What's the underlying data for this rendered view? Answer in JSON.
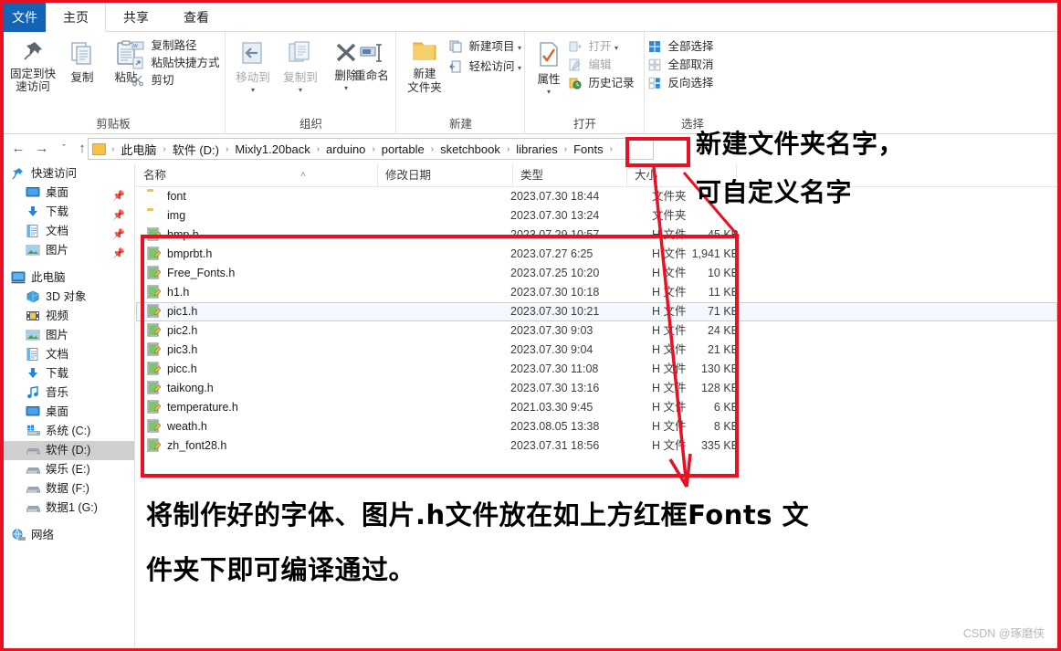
{
  "window": {
    "tabs": [
      {
        "label": "文件",
        "name": "tab-file"
      },
      {
        "label": "主页",
        "name": "tab-home"
      },
      {
        "label": "共享",
        "name": "tab-share"
      },
      {
        "label": "查看",
        "name": "tab-view"
      }
    ]
  },
  "ribbon": {
    "clipboard": {
      "group_label": "剪贴板",
      "pin_to_quick_access": "固定到快\n速访问",
      "pin_line1": "固定到快",
      "pin_line2": "速访问",
      "copy": "复制",
      "paste": "粘贴",
      "copy_path": "复制路径",
      "paste_shortcut": "粘贴快捷方式",
      "cut": "剪切"
    },
    "organize": {
      "group_label": "组织",
      "move_to": "移动到",
      "copy_to": "复制到",
      "delete": "删除",
      "rename": "重命名"
    },
    "new": {
      "group_label": "新建",
      "new_folder_line1": "新建",
      "new_folder_line2": "文件夹",
      "new_item": "新建项目",
      "easy_access": "轻松访问"
    },
    "open": {
      "group_label": "打开",
      "properties": "属性",
      "open": "打开",
      "edit": "编辑",
      "history": "历史记录"
    },
    "select": {
      "group_label": "选择",
      "select_all": "全部选择",
      "select_none": "全部取消",
      "invert_selection": "反向选择"
    }
  },
  "address": {
    "back_icon": "←",
    "forward_icon": "→",
    "recent_icon": "ˇ",
    "up_icon": "↑",
    "breadcrumbs": [
      "此电脑",
      "软件 (D:)",
      "Mixly1.20back",
      "arduino",
      "portable",
      "sketchbook",
      "libraries",
      "Fonts"
    ],
    "separator": "›"
  },
  "sidebar": {
    "groups": [
      {
        "header": {
          "label": "快速访问",
          "icon": "star-pin-icon",
          "name": "sidebar-item-quick-access"
        },
        "items": [
          {
            "label": "桌面",
            "icon": "desktop-icon",
            "pinned": true,
            "name": "sidebar-item-desktop"
          },
          {
            "label": "下载",
            "icon": "download-icon",
            "pinned": true,
            "name": "sidebar-item-downloads"
          },
          {
            "label": "文档",
            "icon": "documents-icon",
            "pinned": true,
            "name": "sidebar-item-documents"
          },
          {
            "label": "图片",
            "icon": "pictures-icon",
            "pinned": true,
            "name": "sidebar-item-pictures"
          }
        ]
      },
      {
        "header": {
          "label": "此电脑",
          "icon": "this-pc-icon",
          "name": "sidebar-item-this-pc"
        },
        "items": [
          {
            "label": "3D 对象",
            "icon": "3d-objects-icon",
            "name": "sidebar-item-3d-objects"
          },
          {
            "label": "视频",
            "icon": "videos-icon",
            "name": "sidebar-item-videos"
          },
          {
            "label": "图片",
            "icon": "pictures-icon",
            "name": "sidebar-item-pictures-pc"
          },
          {
            "label": "文档",
            "icon": "documents-icon",
            "name": "sidebar-item-documents-pc"
          },
          {
            "label": "下载",
            "icon": "download-icon",
            "name": "sidebar-item-downloads-pc"
          },
          {
            "label": "音乐",
            "icon": "music-icon",
            "name": "sidebar-item-music"
          },
          {
            "label": "桌面",
            "icon": "desktop-icon",
            "name": "sidebar-item-desktop-pc"
          },
          {
            "label": "系统 (C:)",
            "icon": "windows-drive-icon",
            "name": "sidebar-item-drive-c"
          },
          {
            "label": "软件 (D:)",
            "icon": "drive-icon",
            "selected": true,
            "name": "sidebar-item-drive-d"
          },
          {
            "label": "娱乐 (E:)",
            "icon": "drive-icon",
            "name": "sidebar-item-drive-e"
          },
          {
            "label": "数据 (F:)",
            "icon": "drive-icon",
            "name": "sidebar-item-drive-f"
          },
          {
            "label": "数据1 (G:)",
            "icon": "drive-icon",
            "name": "sidebar-item-drive-g"
          }
        ]
      },
      {
        "header": {
          "label": "网络",
          "icon": "network-icon",
          "name": "sidebar-item-network"
        },
        "items": []
      }
    ]
  },
  "filelist": {
    "columns": [
      {
        "label": "名称",
        "name": "column-name"
      },
      {
        "label": "修改日期",
        "name": "column-date-modified"
      },
      {
        "label": "类型",
        "name": "column-type"
      },
      {
        "label": "大小",
        "name": "column-size"
      }
    ],
    "sort_indicator": "˄",
    "rows": [
      {
        "name": "font",
        "date": "2023.07.30 18:44",
        "type": "文件夹",
        "size": "",
        "icon": "folder-icon"
      },
      {
        "name": "img",
        "date": "2023.07.30 13:24",
        "type": "文件夹",
        "size": "",
        "icon": "folder-icon"
      },
      {
        "name": "bmp.h",
        "date": "2023.07.29 10:57",
        "type": "H 文件",
        "size": "45 KB",
        "icon": "h-file-icon"
      },
      {
        "name": "bmprbt.h",
        "date": "2023.07.27 6:25",
        "type": "H 文件",
        "size": "1,941 KB",
        "icon": "h-file-icon"
      },
      {
        "name": "Free_Fonts.h",
        "date": "2023.07.25 10:20",
        "type": "H 文件",
        "size": "10 KB",
        "icon": "h-file-icon"
      },
      {
        "name": "h1.h",
        "date": "2023.07.30 10:18",
        "type": "H 文件",
        "size": "11 KB",
        "icon": "h-file-icon"
      },
      {
        "name": "pic1.h",
        "date": "2023.07.30 10:21",
        "type": "H 文件",
        "size": "71 KB",
        "icon": "h-file-icon",
        "hover": true
      },
      {
        "name": "pic2.h",
        "date": "2023.07.30 9:03",
        "type": "H 文件",
        "size": "24 KB",
        "icon": "h-file-icon"
      },
      {
        "name": "pic3.h",
        "date": "2023.07.30 9:04",
        "type": "H 文件",
        "size": "21 KB",
        "icon": "h-file-icon"
      },
      {
        "name": "picc.h",
        "date": "2023.07.30 11:08",
        "type": "H 文件",
        "size": "130 KB",
        "icon": "h-file-icon"
      },
      {
        "name": "taikong.h",
        "date": "2023.07.30 13:16",
        "type": "H 文件",
        "size": "128 KB",
        "icon": "h-file-icon"
      },
      {
        "name": "temperature.h",
        "date": "2021.03.30 9:45",
        "type": "H 文件",
        "size": "6 KB",
        "icon": "h-file-icon"
      },
      {
        "name": "weath.h",
        "date": "2023.08.05 13:38",
        "type": "H 文件",
        "size": "8 KB",
        "icon": "h-file-icon"
      },
      {
        "name": "zh_font28.h",
        "date": "2023.07.31 18:56",
        "type": "H 文件",
        "size": "335 KB",
        "icon": "h-file-icon"
      }
    ]
  },
  "annotations": {
    "top_line1": "新建文件夹名字，",
    "top_line2": "可自定义名字",
    "bottom_line1": "将制作好的字体、图片.h文件放在如上方红框Fonts 文",
    "bottom_line2": "件夹下即可编译通过。"
  },
  "watermark": {
    "text": "CSDN @琢磨侠"
  },
  "colors": {
    "accent": "#1364b5",
    "annotation_red": "#e81123",
    "folder_yellow": "#f2c14a",
    "selection_gray": "#cfcfcf",
    "hover_blue": "#f2f8fd"
  }
}
